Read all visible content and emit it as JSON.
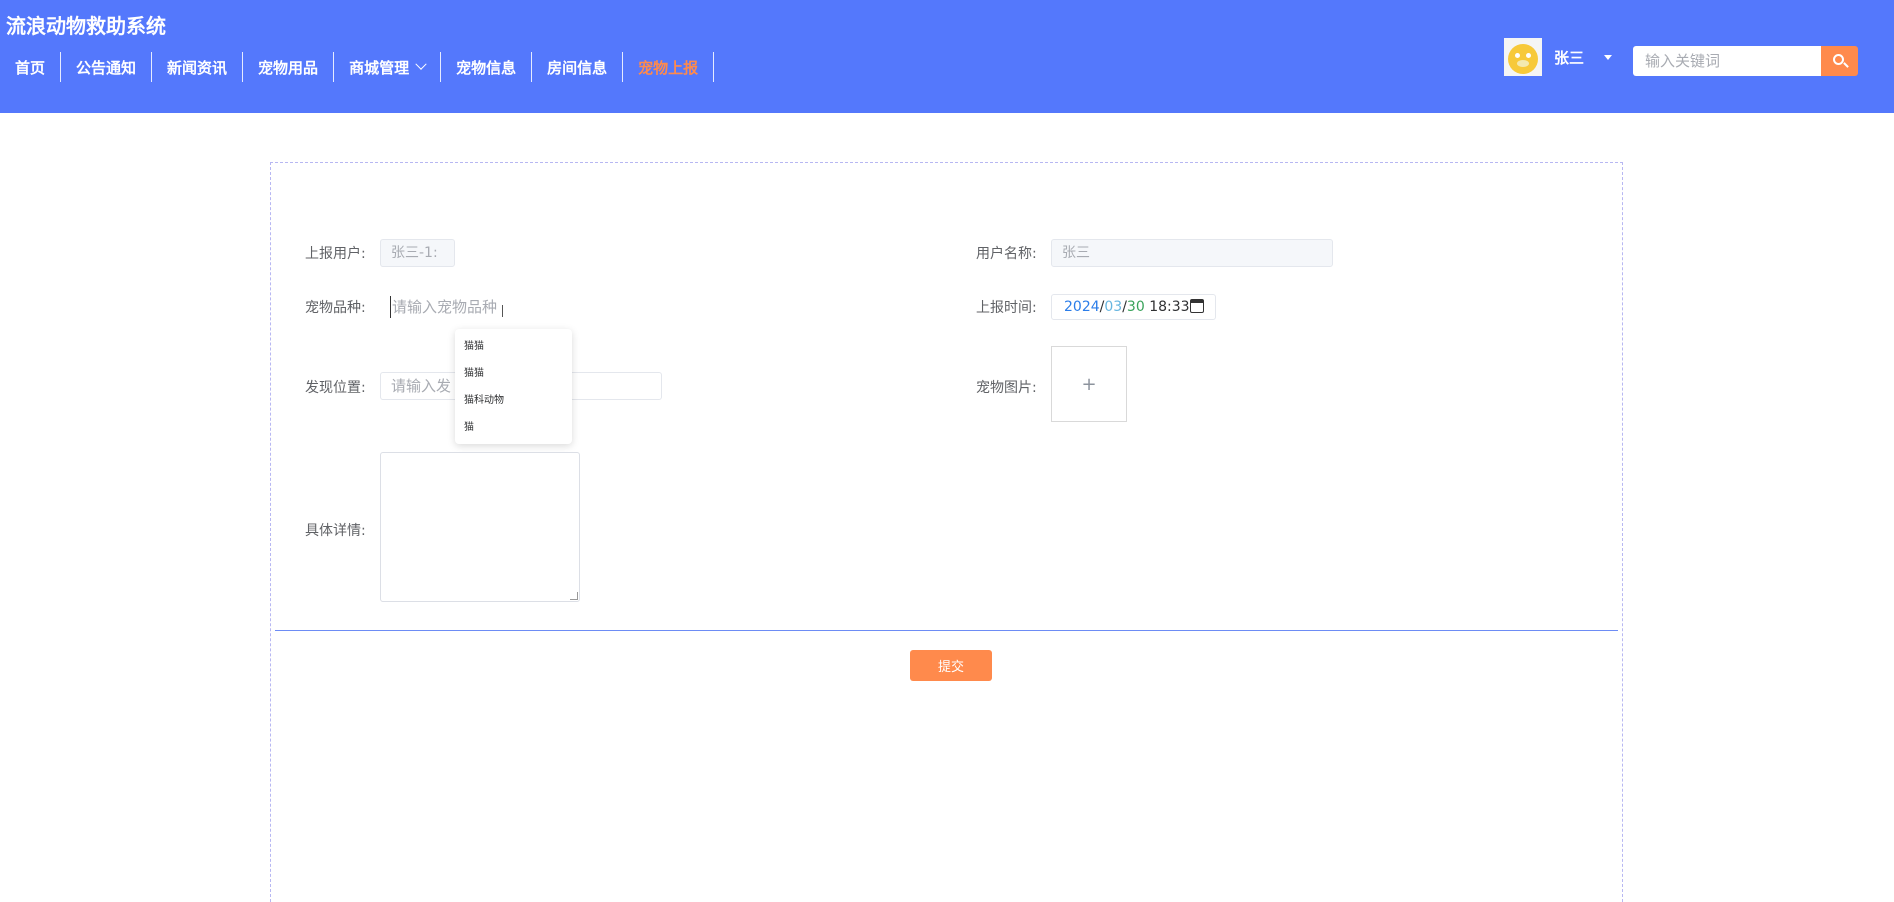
{
  "header": {
    "site_title": "流浪动物救助系统",
    "nav": [
      {
        "label": "首页"
      },
      {
        "label": "公告通知"
      },
      {
        "label": "新闻资讯"
      },
      {
        "label": "宠物用品"
      },
      {
        "label": "商城管理"
      },
      {
        "label": "宠物信息"
      },
      {
        "label": "房间信息"
      },
      {
        "label": "宠物上报"
      }
    ],
    "user_name": "张三",
    "search_placeholder": "输入关键词",
    "colors": {
      "bar": "#5478fc",
      "accent": "#ff8a4c"
    }
  },
  "form": {
    "reporter_label": "上报用户:",
    "reporter_value": "张三-1:",
    "username_label": "用户名称:",
    "username_value": "张三",
    "species_label": "宠物品种:",
    "species_placeholder": "请输入宠物品种",
    "species_suggestions": [
      "猫猫",
      "猫猫",
      "猫科动物",
      "猫"
    ],
    "time_label": "上报时间:",
    "time_year": "2024",
    "time_month": "03",
    "time_day": "30",
    "time_clock": "18:33",
    "location_label": "发现位置:",
    "location_placeholder": "请输入发",
    "image_label": "宠物图片:",
    "upload_plus": "+",
    "detail_label": "具体详情:",
    "submit_label": "提交"
  }
}
